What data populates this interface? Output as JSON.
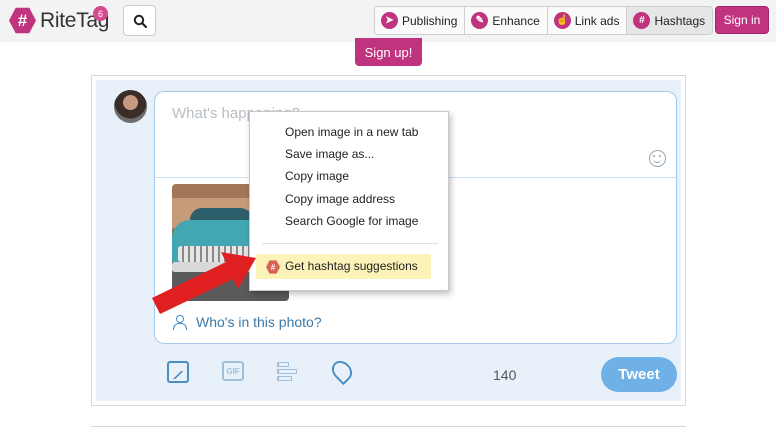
{
  "header": {
    "logo_text": "RiteTag",
    "logo_mark": "#",
    "badge_count": "6",
    "nav": [
      {
        "label": "Publishing",
        "icon": "paper-plane-icon",
        "glyph": "➤"
      },
      {
        "label": "Enhance",
        "icon": "magic-wand-icon",
        "glyph": "✎"
      },
      {
        "label": "Link ads",
        "icon": "pointer-hand-icon",
        "glyph": "☝"
      },
      {
        "label": "Hashtags",
        "icon": "hashtag-icon",
        "glyph": "#"
      }
    ],
    "signin_label": "Sign in",
    "signup_label": "Sign up!"
  },
  "composer": {
    "placeholder": "What's happening?",
    "who_in_photo": "Who's in this photo?",
    "gif_label": "GIF",
    "char_count": "140",
    "tweet_label": "Tweet"
  },
  "context_menu": {
    "items": [
      "Open image in a new tab",
      "Save image as...",
      "Copy image",
      "Copy image address",
      "Search Google for image"
    ],
    "extension_item": "Get hashtag suggestions",
    "extension_icon": "#"
  },
  "colors": {
    "brand": "#c0337e",
    "tweet_button": "#6fb1e6",
    "highlight": "#fbf3b8",
    "arrow": "#e02020"
  }
}
